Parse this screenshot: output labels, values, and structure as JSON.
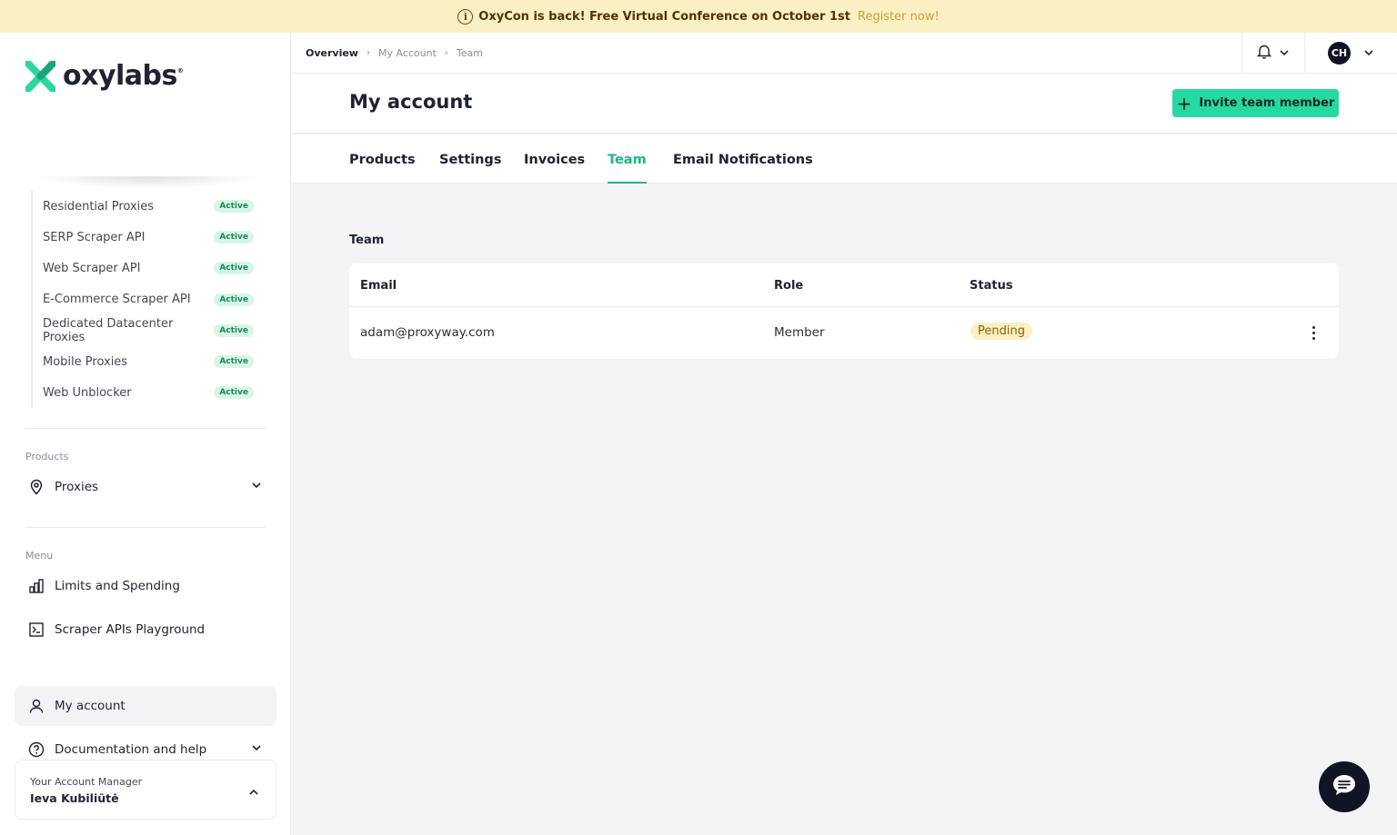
{
  "banner": {
    "message": "OxyCon is back! Free Virtual Conference on October 1st",
    "link": "Register now!"
  },
  "brand": {
    "name": "oxylabs",
    "mark": "®",
    "accent": "#26d9a3"
  },
  "sidebar": {
    "products_list": [
      {
        "label": "Residential Proxies",
        "status": "Active"
      },
      {
        "label": "SERP Scraper API",
        "status": "Active"
      },
      {
        "label": "Web Scraper API",
        "status": "Active"
      },
      {
        "label": "E-Commerce Scraper API",
        "status": "Active"
      },
      {
        "label": "Dedicated Datacenter Proxies",
        "status": "Active"
      },
      {
        "label": "Mobile Proxies",
        "status": "Active"
      },
      {
        "label": "Web Unblocker",
        "status": "Active"
      }
    ],
    "products_label": "Products",
    "proxies": "Proxies",
    "menu_label": "Menu",
    "menu": {
      "limits": "Limits and Spending",
      "playground": "Scraper APIs Playground",
      "account": "My account",
      "docs": "Documentation and help"
    },
    "manager": {
      "label": "Your Account Manager",
      "name": "Ieva Kubiliūtė"
    }
  },
  "breadcrumb": {
    "c1": "Overview",
    "c2": "My Account",
    "c3": "Team"
  },
  "user": {
    "initials": "CH"
  },
  "header": {
    "title": "My account",
    "invite": "Invite team member"
  },
  "tabs": {
    "products": "Products",
    "settings": "Settings",
    "invoices": "Invoices",
    "team": "Team",
    "email": "Email Notifications"
  },
  "team": {
    "title": "Team",
    "columns": {
      "email": "Email",
      "role": "Role",
      "status": "Status"
    },
    "rows": [
      {
        "email": "adam@proxyway.com",
        "role": "Member",
        "status": "Pending"
      }
    ]
  }
}
